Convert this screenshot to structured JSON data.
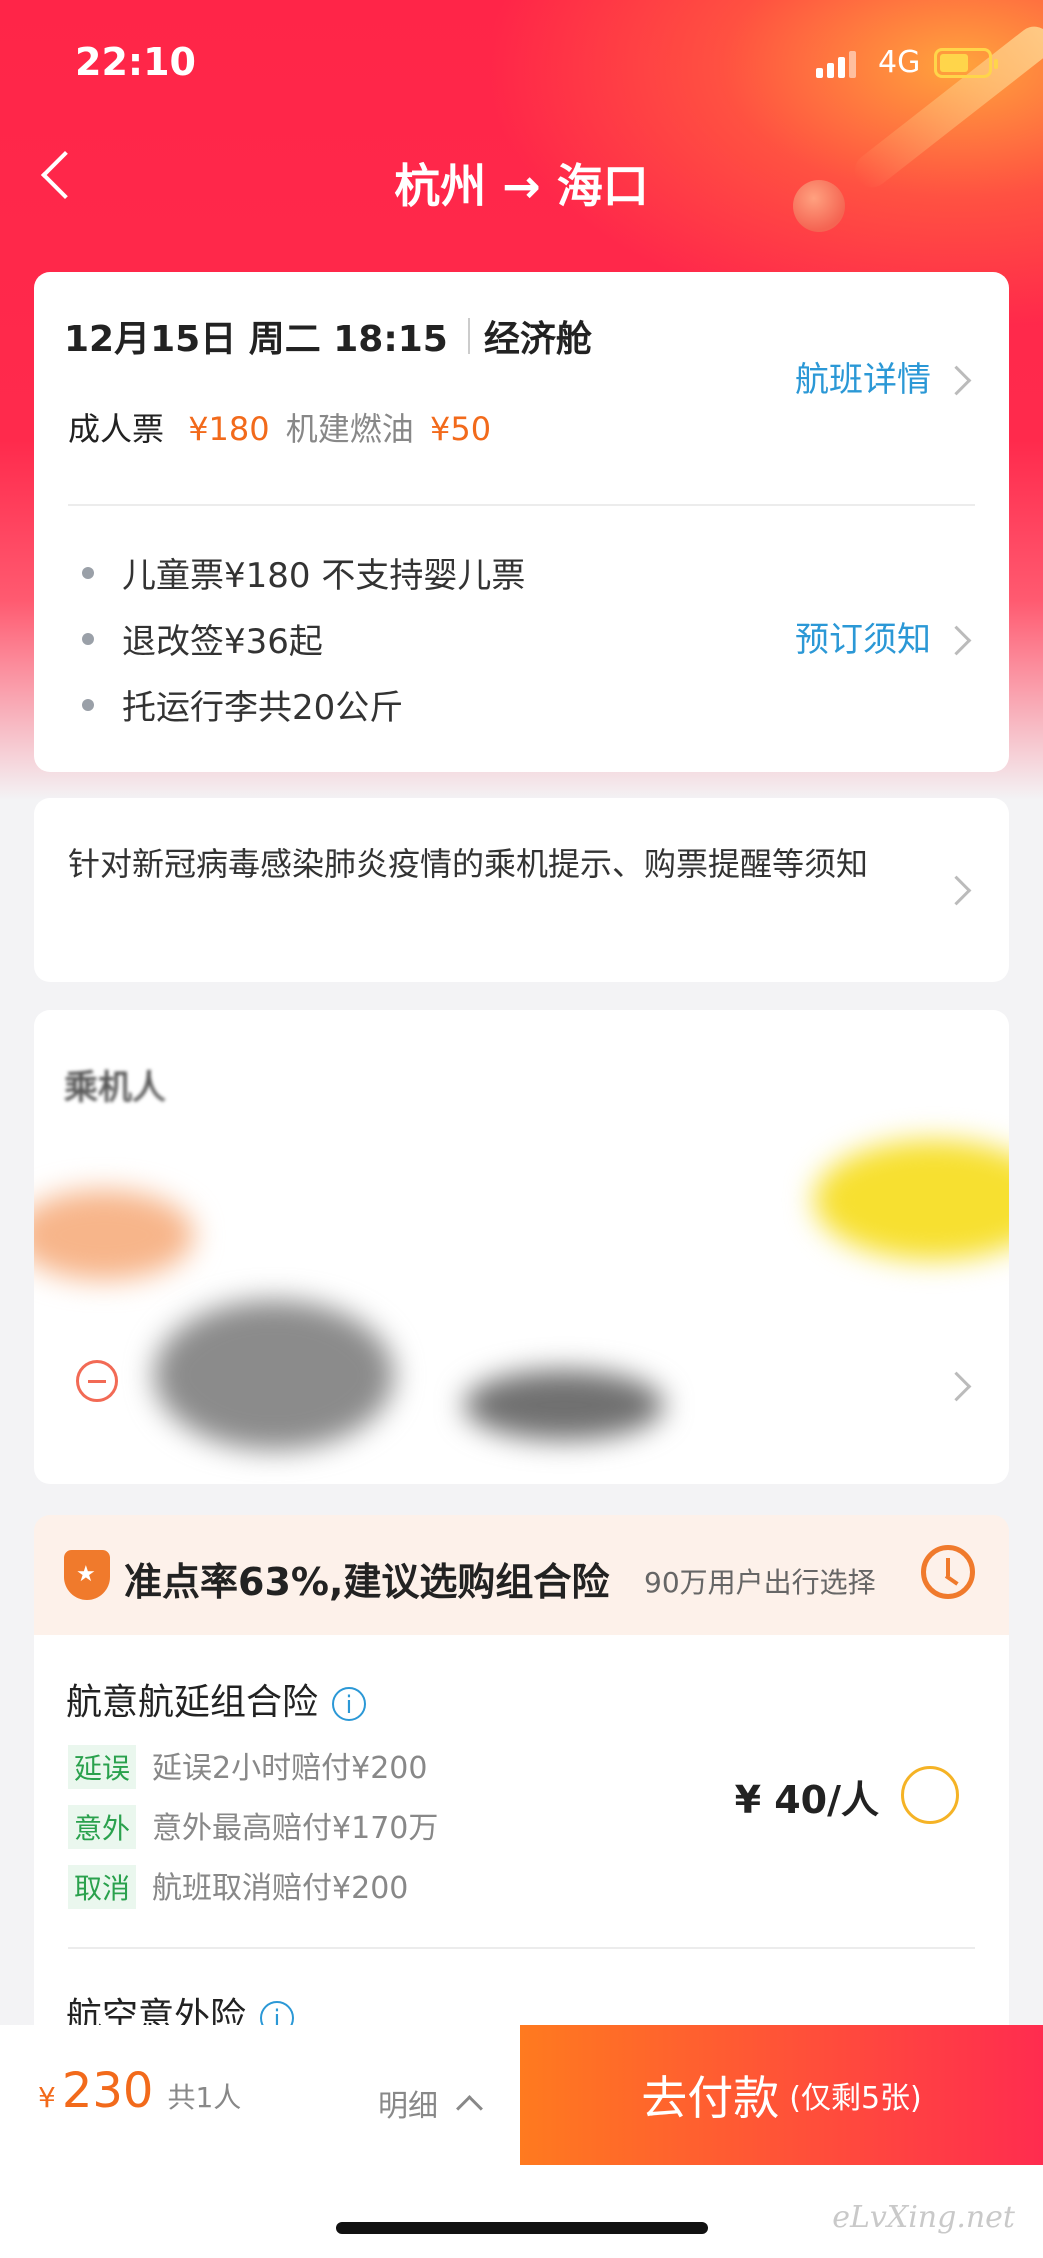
{
  "status_bar": {
    "time": "22:10",
    "network": "4G"
  },
  "nav": {
    "title": "杭州 → 海口"
  },
  "flight_card": {
    "date_time": "12月15日 周二 18:15",
    "cabin": "经济舱",
    "adult_label": "成人票",
    "adult_price": "¥180",
    "fee_label": "机建燃油",
    "fee_price": "¥50",
    "detail_link": "航班详情",
    "bullets": [
      "儿童票¥180  不支持婴儿票",
      "退改签¥36起",
      "托运行李共20公斤"
    ],
    "notice_link": "预订须知"
  },
  "covid_notice": {
    "text": "针对新冠病毒感染肺炎疫情的乘机提示、购票提醒等须知"
  },
  "passenger": {
    "title": "乘机人"
  },
  "insurance": {
    "banner_title": "准点率63%,建议选购组合险",
    "banner_sub": "90万用户出行选择",
    "combo": {
      "title": "航意航延组合险",
      "items": [
        {
          "tag": "延误",
          "text": "延误2小时赔付¥200"
        },
        {
          "tag": "意外",
          "text": "意外最高赔付¥170万"
        },
        {
          "tag": "取消",
          "text": "航班取消赔付¥200"
        }
      ],
      "price": "¥ 40/人"
    },
    "next_title": "航空意外险"
  },
  "footer": {
    "currency": "¥",
    "total": "230",
    "count": "共1人",
    "detail": "明细",
    "pay_label": "去付款",
    "pay_sub": "(仅剩5张)"
  },
  "watermark": "eLvXing.net",
  "colors": {
    "brand_red": "#ff2548",
    "orange": "#f26a1b",
    "link_blue": "#2b98d6",
    "tag_green": "#2aa14d"
  }
}
